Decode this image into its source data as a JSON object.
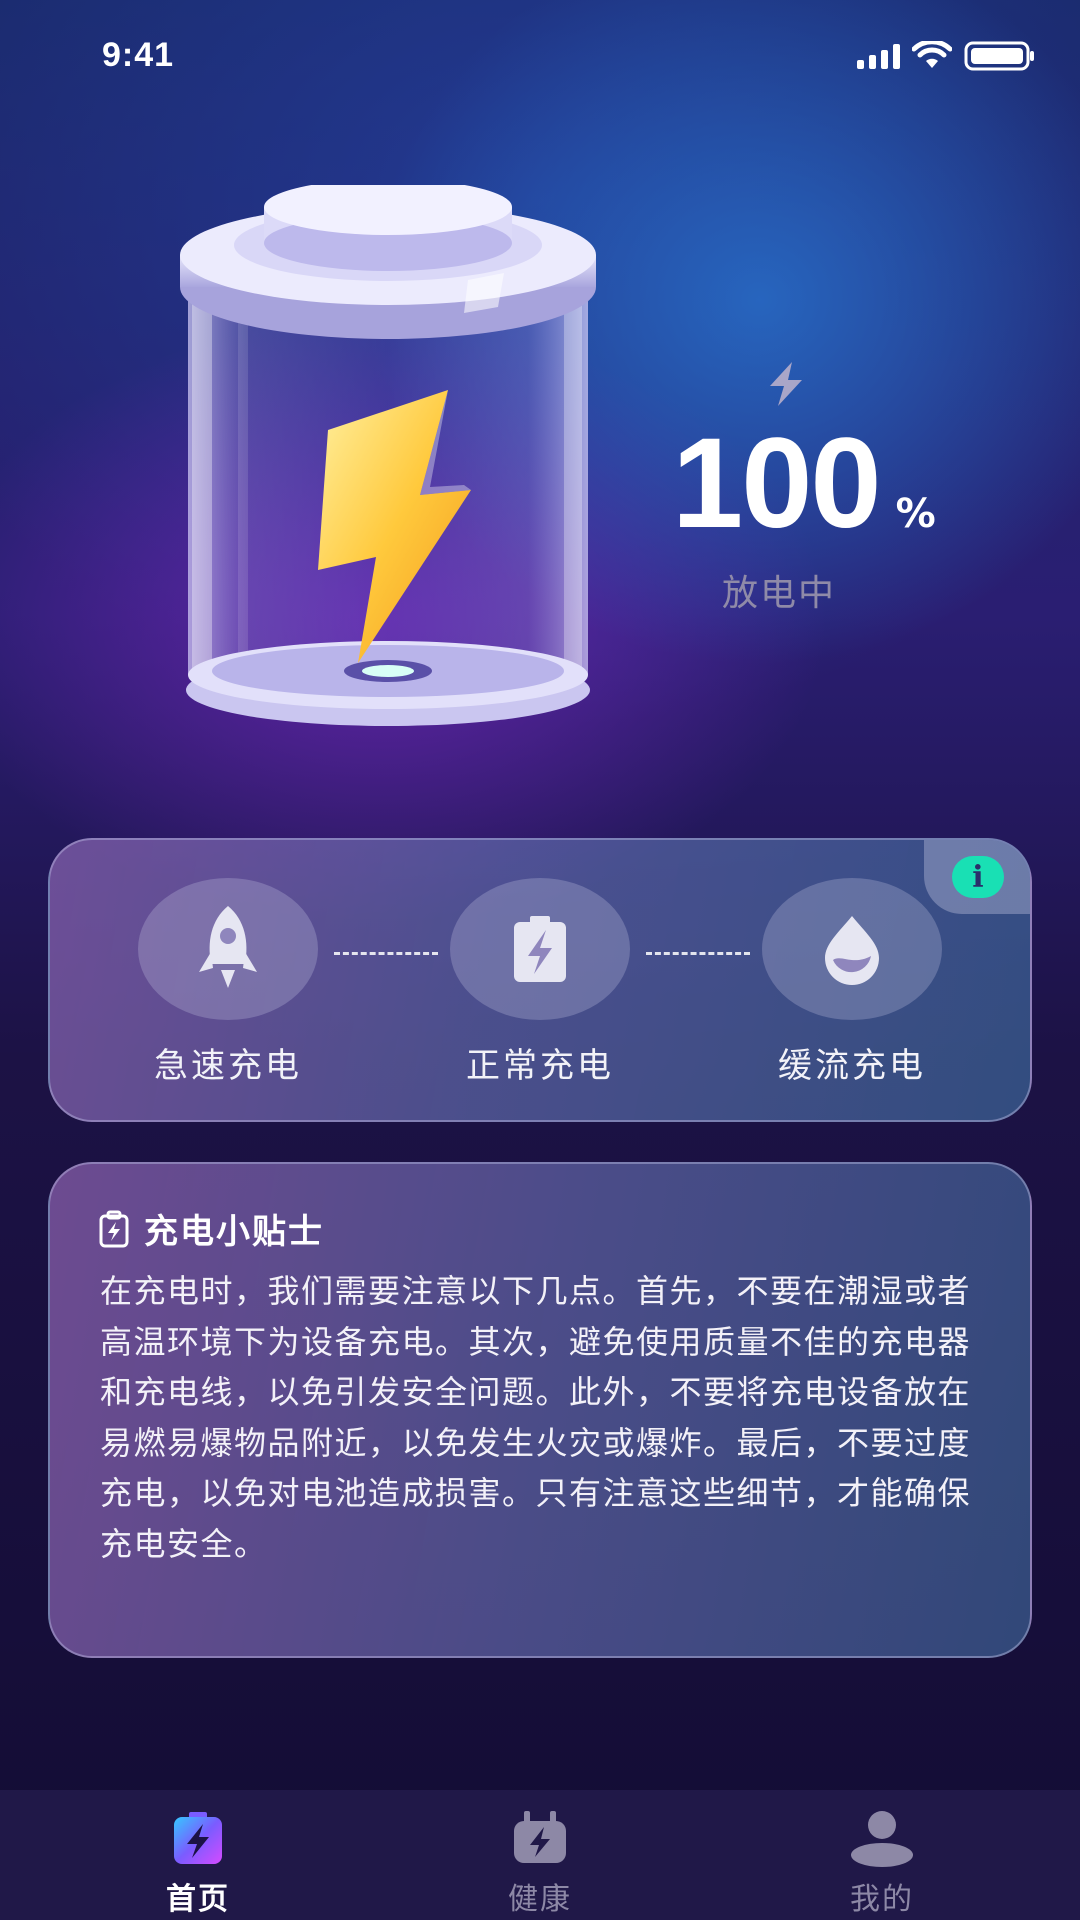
{
  "status_bar": {
    "time": "9:41",
    "icons": [
      "signal-icon",
      "wifi-icon",
      "battery-icon"
    ]
  },
  "hero": {
    "percent": "100",
    "percent_unit": "%",
    "status": "放电中",
    "icons": [
      "battery-illustration",
      "bolt-icon"
    ]
  },
  "charge_modes": {
    "info_icon": "info-icon",
    "items": [
      {
        "label": "急速充电",
        "icon": "rocket-icon"
      },
      {
        "label": "正常充电",
        "icon": "battery-bolt-icon"
      },
      {
        "label": "缓流充电",
        "icon": "water-drop-icon"
      }
    ]
  },
  "tips": {
    "title": "充电小贴士",
    "icon": "battery-clipboard-icon",
    "body": "在充电时，我们需要注意以下几点。首先，不要在潮湿或者高温环境下为设备充电。其次，避免使用质量不佳的充电器和充电线，以免引发安全问题。此外，不要将充电设备放在易燃易爆物品附近，以免发生火灾或爆炸。最后，不要过度充电，以免对电池造成损害。只有注意这些细节，才能确保充电安全。"
  },
  "bottom_nav": {
    "active_index": 0,
    "items": [
      {
        "label": "首页",
        "icon": "home-bolt-icon"
      },
      {
        "label": "健康",
        "icon": "charger-icon"
      },
      {
        "label": "我的",
        "icon": "user-icon"
      }
    ]
  },
  "colors": {
    "accent_teal": "#19e0b4",
    "bolt_yellow": "#ffc93c",
    "nav_bg": "#201848",
    "muted_text": "#8f8aa8"
  }
}
